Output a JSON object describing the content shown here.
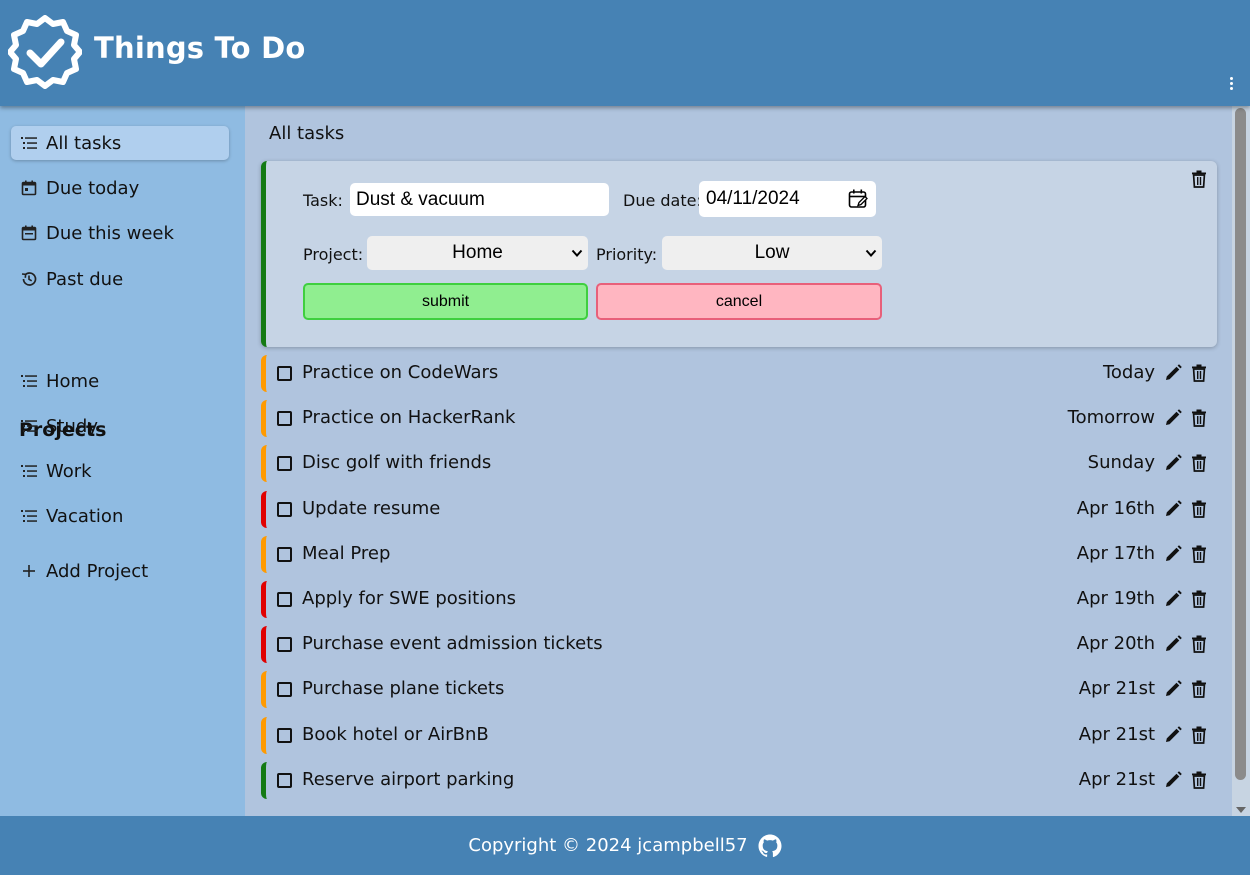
{
  "app": {
    "title": "Things To Do",
    "logo_icon": "badge-check-icon",
    "menu_icon": "kebab-menu-icon"
  },
  "colors": {
    "header_bg": "#4682b4",
    "sidebar_bg": "#8fbbe2",
    "main_bg": "#b0c4de",
    "priority_high": "#e00000",
    "priority_medium": "#ff9a00",
    "priority_low": "#147a14"
  },
  "sidebar": {
    "filters": [
      {
        "label": "All tasks",
        "icon": "list-icon",
        "active": true
      },
      {
        "label": "Due today",
        "icon": "calendar-icon"
      },
      {
        "label": "Due this week",
        "icon": "calendar-icon"
      },
      {
        "label": "Past due",
        "icon": "history-icon"
      }
    ],
    "projects_heading": "Projects",
    "projects": [
      {
        "label": "Home",
        "icon": "list-icon"
      },
      {
        "label": "Study",
        "icon": "list-icon"
      },
      {
        "label": "Work",
        "icon": "list-icon"
      },
      {
        "label": "Vacation",
        "icon": "list-icon"
      }
    ],
    "add_project": {
      "label": "Add Project",
      "icon": "plus-icon"
    }
  },
  "main": {
    "title": "All tasks",
    "edit_form": {
      "task_label": "Task:",
      "task_value": "Dust & vacuum",
      "due_label": "Due date:",
      "due_value": "04/11/2024",
      "project_label": "Project:",
      "project_value": "Home",
      "priority_label": "Priority:",
      "priority_value": "Low",
      "submit_label": "submit",
      "cancel_label": "cancel"
    },
    "tasks": [
      {
        "title": "Practice on CodeWars",
        "due": "Today",
        "priority": "medium"
      },
      {
        "title": "Practice on HackerRank",
        "due": "Tomorrow",
        "priority": "medium"
      },
      {
        "title": "Disc golf with friends",
        "due": "Sunday",
        "priority": "medium"
      },
      {
        "title": "Update resume",
        "due": "Apr 16th",
        "priority": "high"
      },
      {
        "title": "Meal Prep",
        "due": "Apr 17th",
        "priority": "medium"
      },
      {
        "title": "Apply for SWE positions",
        "due": "Apr 19th",
        "priority": "high"
      },
      {
        "title": "Purchase event admission tickets",
        "due": "Apr 20th",
        "priority": "high"
      },
      {
        "title": "Purchase plane tickets",
        "due": "Apr 21st",
        "priority": "medium"
      },
      {
        "title": "Book hotel or AirBnB",
        "due": "Apr 21st",
        "priority": "medium"
      },
      {
        "title": "Reserve airport parking",
        "due": "Apr 21st",
        "priority": "low"
      }
    ]
  },
  "footer": {
    "text": "Copyright © 2024 jcampbell57",
    "icon": "github-icon"
  }
}
